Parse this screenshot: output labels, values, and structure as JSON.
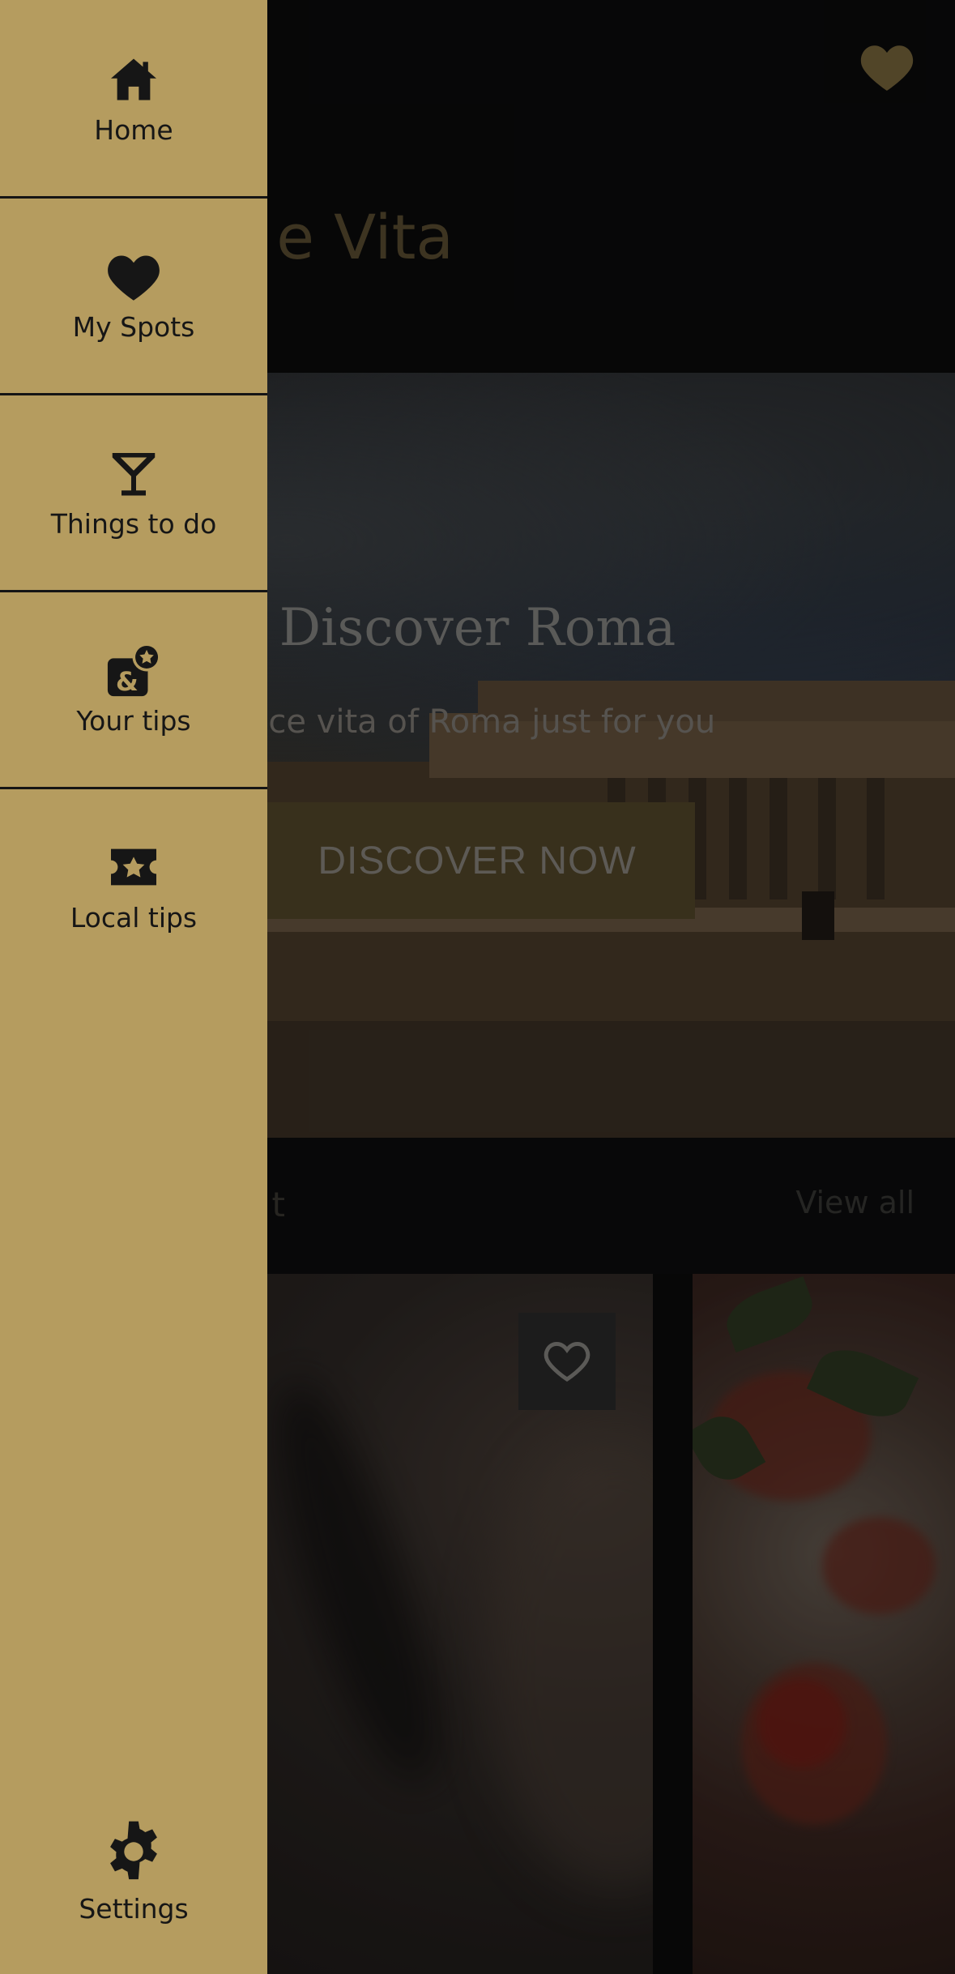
{
  "app": {
    "title_fragment": "e Vita",
    "hero": {
      "title": "Discover Roma",
      "subtitle": "olce vita of Roma just for you",
      "cta_label": "DISCOVER NOW"
    },
    "section": {
      "title_fragment": "t",
      "view_all_label": "View all"
    }
  },
  "drawer": {
    "items": [
      {
        "label": "Home",
        "icon": "home-icon"
      },
      {
        "label": "My Spots",
        "icon": "heart-icon"
      },
      {
        "label": "Things to do",
        "icon": "cocktail-icon"
      },
      {
        "label": "Your tips",
        "icon": "map-pin-star-icon"
      },
      {
        "label": "Local tips",
        "icon": "ticket-star-icon"
      }
    ],
    "settings": {
      "label": "Settings",
      "icon": "gear-icon"
    }
  },
  "colors": {
    "drawer_bg": "#b59c5f",
    "accent_gold": "#8f7a48",
    "dark_bg": "#0b0b0c",
    "text_dark": "#161616"
  }
}
